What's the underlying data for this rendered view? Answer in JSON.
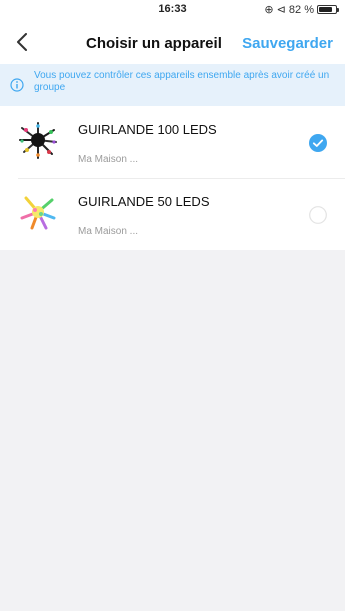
{
  "status_bar": {
    "time": "16:33",
    "indicators": "⊕ ⊲ 82 %",
    "battery_percent": 82
  },
  "nav": {
    "back_icon": "chevron-left-icon",
    "title": "Choisir un appareil",
    "save_label": "Sauvegarder"
  },
  "info_banner": {
    "icon": "info-icon",
    "text": "Vous pouvez contrôler ces appareils ensemble après avoir créé un groupe"
  },
  "devices": [
    {
      "name": "GUIRLANDE 100 LEDS",
      "location": "Ma Maison ...",
      "selected": true
    },
    {
      "name": "GUIRLANDE 50 LEDS",
      "location": "Ma Maison ...",
      "selected": false
    }
  ],
  "colors": {
    "accent": "#3fa7f0",
    "banner_bg": "#e6f1fb",
    "page_bg": "#f2f2f4",
    "muted_text": "#9b9b9b"
  }
}
